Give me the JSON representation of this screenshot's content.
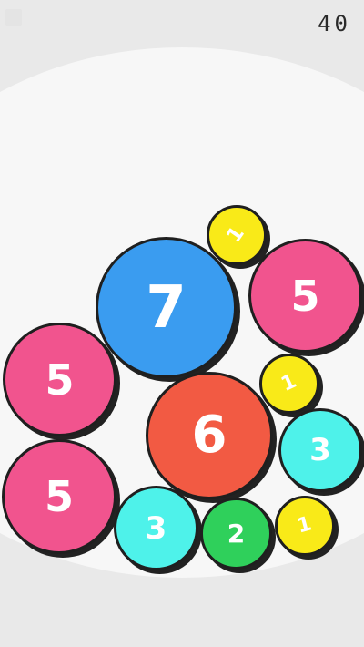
{
  "score": "40",
  "balls": {
    "yellow_top": {
      "value": "1",
      "color": "#f9ea18"
    },
    "blue": {
      "value": "7",
      "color": "#3a9cf0"
    },
    "pink_right": {
      "value": "5",
      "color": "#f1548e"
    },
    "pink_mid": {
      "value": "5",
      "color": "#f1548e"
    },
    "yellow_mid": {
      "value": "1",
      "color": "#f9ea18"
    },
    "red": {
      "value": "6",
      "color": "#f25a43"
    },
    "cyan_right": {
      "value": "3",
      "color": "#4ef2ea"
    },
    "pink_bottom": {
      "value": "5",
      "color": "#f1548e"
    },
    "cyan_bottom": {
      "value": "3",
      "color": "#4ef2ea"
    },
    "green": {
      "value": "2",
      "color": "#2fd05b"
    },
    "yellow_bottom": {
      "value": "1",
      "color": "#f9ea18"
    }
  }
}
